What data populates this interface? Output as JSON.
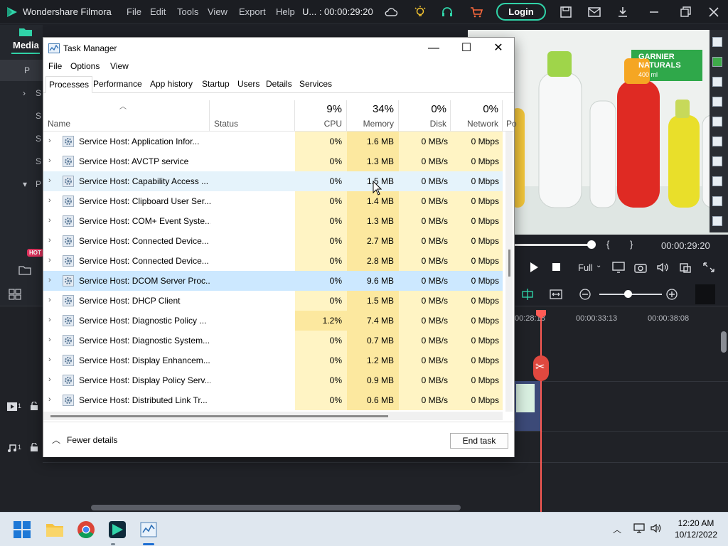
{
  "filmora": {
    "app_name": "Wondershare Filmora",
    "menu": [
      "File",
      "Edit",
      "Tools",
      "View",
      "Export",
      "Help"
    ],
    "project_time": "U... : 00:00:29:20",
    "login": "Login",
    "media_tab": "Media",
    "sidebar_items": [
      "P",
      "S",
      "S",
      "S",
      "S",
      "P"
    ],
    "hot_badge": "HOT",
    "preview_brand": "GARNIER NATURALS",
    "preview_volume": "400 ml",
    "timecode": "00:00:29:20",
    "zoom": "Full",
    "ruler": [
      "00:28:18",
      "00:00:33:13",
      "00:00:38:08"
    ],
    "track_video_num": "1",
    "track_audio_num": "1"
  },
  "taskmgr": {
    "title": "Task Manager",
    "menu": [
      "File",
      "Options",
      "View"
    ],
    "tabs": [
      "Processes",
      "Performance",
      "App history",
      "Startup",
      "Users",
      "Details",
      "Services"
    ],
    "active_tab": "Processes",
    "columns": {
      "name": "Name",
      "status": "Status",
      "cpu": {
        "pct": "9%",
        "label": "CPU"
      },
      "memory": {
        "pct": "34%",
        "label": "Memory"
      },
      "disk": {
        "pct": "0%",
        "label": "Disk"
      },
      "network": {
        "pct": "0%",
        "label": "Network"
      },
      "power": "Po"
    },
    "rows": [
      {
        "name": "Service Host: Application Infor...",
        "cpu": "0%",
        "memory": "1.6 MB",
        "disk": "0 MB/s",
        "network": "0 Mbps"
      },
      {
        "name": "Service Host: AVCTP service",
        "cpu": "0%",
        "memory": "1.3 MB",
        "disk": "0 MB/s",
        "network": "0 Mbps"
      },
      {
        "name": "Service Host: Capability Access ...",
        "cpu": "0%",
        "memory": "1.5 MB",
        "disk": "0 MB/s",
        "network": "0 Mbps"
      },
      {
        "name": "Service Host: Clipboard User Ser...",
        "cpu": "0%",
        "memory": "1.4 MB",
        "disk": "0 MB/s",
        "network": "0 Mbps"
      },
      {
        "name": "Service Host: COM+ Event Syste...",
        "cpu": "0%",
        "memory": "1.3 MB",
        "disk": "0 MB/s",
        "network": "0 Mbps"
      },
      {
        "name": "Service Host: Connected Device...",
        "cpu": "0%",
        "memory": "2.7 MB",
        "disk": "0 MB/s",
        "network": "0 Mbps"
      },
      {
        "name": "Service Host: Connected Device...",
        "cpu": "0%",
        "memory": "2.8 MB",
        "disk": "0 MB/s",
        "network": "0 Mbps"
      },
      {
        "name": "Service Host: DCOM Server Proc...",
        "cpu": "0%",
        "memory": "9.6 MB",
        "disk": "0 MB/s",
        "network": "0 Mbps"
      },
      {
        "name": "Service Host: DHCP Client",
        "cpu": "0%",
        "memory": "1.5 MB",
        "disk": "0 MB/s",
        "network": "0 Mbps"
      },
      {
        "name": "Service Host: Diagnostic Policy ...",
        "cpu": "1.2%",
        "memory": "7.4 MB",
        "disk": "0 MB/s",
        "network": "0 Mbps"
      },
      {
        "name": "Service Host: Diagnostic System...",
        "cpu": "0%",
        "memory": "0.7 MB",
        "disk": "0 MB/s",
        "network": "0 Mbps"
      },
      {
        "name": "Service Host: Display Enhancem...",
        "cpu": "0%",
        "memory": "1.2 MB",
        "disk": "0 MB/s",
        "network": "0 Mbps"
      },
      {
        "name": "Service Host: Display Policy Serv...",
        "cpu": "0%",
        "memory": "0.9 MB",
        "disk": "0 MB/s",
        "network": "0 Mbps"
      },
      {
        "name": "Service Host: Distributed Link Tr...",
        "cpu": "0%",
        "memory": "0.6 MB",
        "disk": "0 MB/s",
        "network": "0 Mbps"
      }
    ],
    "hover_row": 2,
    "selected_row": 7,
    "fewer_details": "Fewer details",
    "end_task": "End task"
  },
  "taskbar": {
    "time": "12:20 AM",
    "date": "10/12/2022"
  }
}
